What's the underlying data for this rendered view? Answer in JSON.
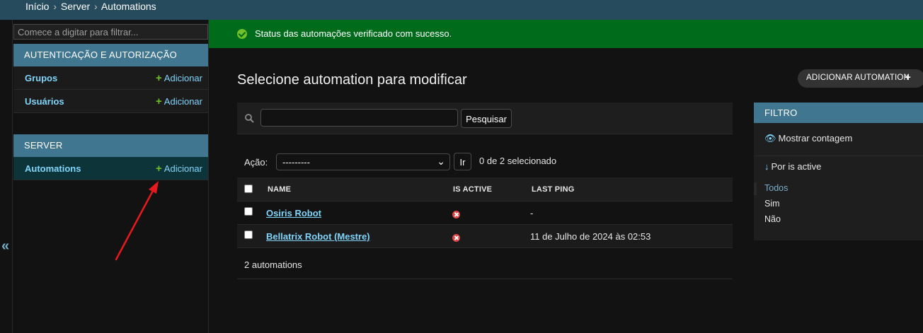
{
  "breadcrumb": {
    "home": "Início",
    "app": "Server",
    "current": "Automations",
    "separator": "›"
  },
  "sidebar": {
    "filter_placeholder": "Comece a digitar para filtrar...",
    "collapse_glyph": "«",
    "modules": [
      {
        "caption": "AUTENTICAÇÃO E AUTORIZAÇÃO",
        "items": [
          {
            "label": "Grupos",
            "add_label": "Adicionar"
          },
          {
            "label": "Usuários",
            "add_label": "Adicionar"
          }
        ]
      },
      {
        "caption": "SERVER",
        "items": [
          {
            "label": "Automations",
            "add_label": "Adicionar"
          }
        ]
      }
    ]
  },
  "message": {
    "text": "Status das automações verificado com sucesso."
  },
  "main": {
    "title": "Selecione automation para modificar",
    "add_button_label": "ADICIONAR AUTOMATION",
    "search": {
      "value": "",
      "button_label": "Pesquisar"
    },
    "actions": {
      "label": "Ação:",
      "selected": "---------",
      "go_label": "Ir",
      "counter": "0 de 2 selecionado"
    },
    "columns": [
      "NAME",
      "IS ACTIVE",
      "LAST PING"
    ],
    "rows": [
      {
        "name": "Osiris Robot",
        "is_active": false,
        "last_ping": "-"
      },
      {
        "name": "Bellatrix Robot (Mestre)",
        "is_active": false,
        "last_ping": "11 de Julho de 2024 às 02:53"
      }
    ],
    "paginator": "2 automations"
  },
  "filter": {
    "title": "FILTRO",
    "show_counts": "Mostrar contagem",
    "by_label": "Por is active",
    "options": [
      "Todos",
      "Sim",
      "Não"
    ],
    "selected_option": "Todos"
  },
  "colors": {
    "header": "#264b5d",
    "module_caption": "#417690",
    "success": "#006b1b",
    "link": "#81d4fa",
    "add_plus": "#6ebf26",
    "inactive_icon": "#dd4646",
    "annotation_arrow": "#e8191e"
  }
}
